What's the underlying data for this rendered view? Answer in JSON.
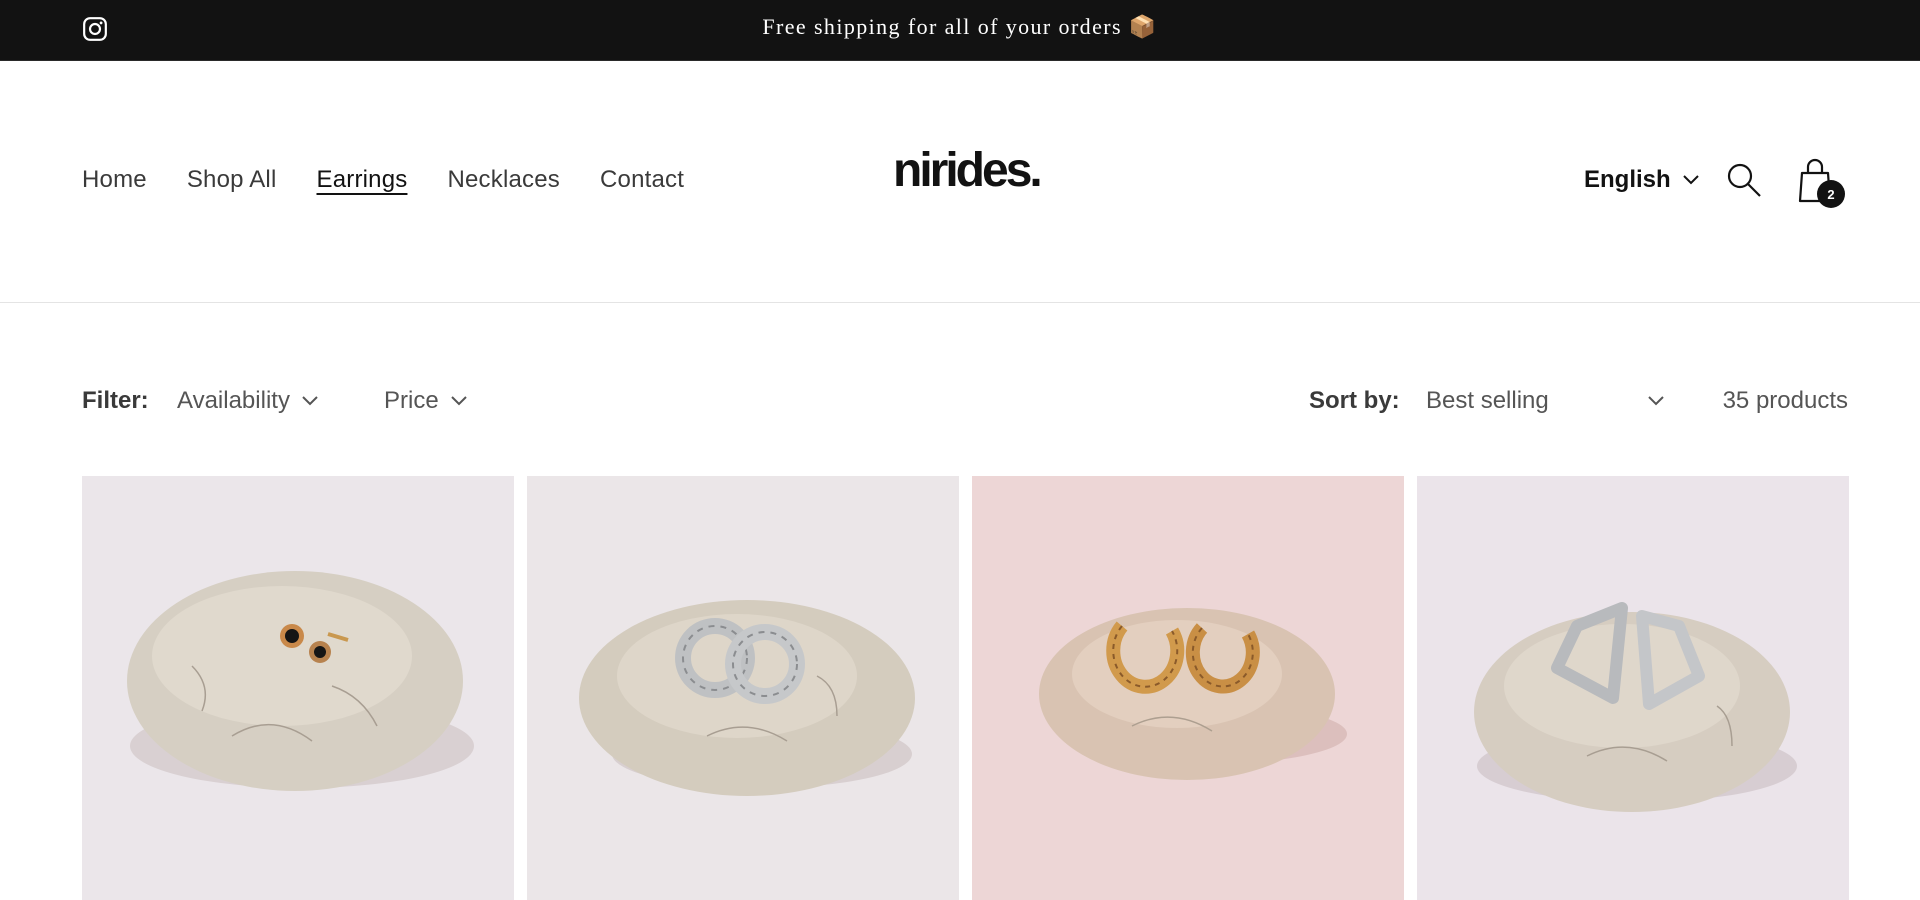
{
  "announcement": {
    "text": "Free shipping for all of your orders 📦",
    "icon": "instagram-icon"
  },
  "header": {
    "nav": [
      "Home",
      "Shop All",
      "Earrings",
      "Necklaces",
      "Contact"
    ],
    "active_nav": "Earrings",
    "logo": "nirides.",
    "language": "English",
    "cart_count": "2"
  },
  "filters": {
    "label": "Filter:",
    "availability": "Availability",
    "price": "Price",
    "sort_label": "Sort by:",
    "sort_value": "Best selling",
    "product_count": "35 products"
  },
  "products": [
    {
      "image": "black-stud-earrings-on-stone",
      "background": "#ebe6ea"
    },
    {
      "image": "silver-twisted-hoop-earrings-on-stone",
      "background": "#ebe6e8"
    },
    {
      "image": "gold-twisted-hoop-earrings-on-stone",
      "background": "#edd6d6"
    },
    {
      "image": "silver-geometric-hoop-earrings-on-stone",
      "background": "#ebe4ea"
    }
  ],
  "colors": {
    "announcement_bg": "#121212",
    "text": "#121212",
    "muted": "#555555"
  }
}
